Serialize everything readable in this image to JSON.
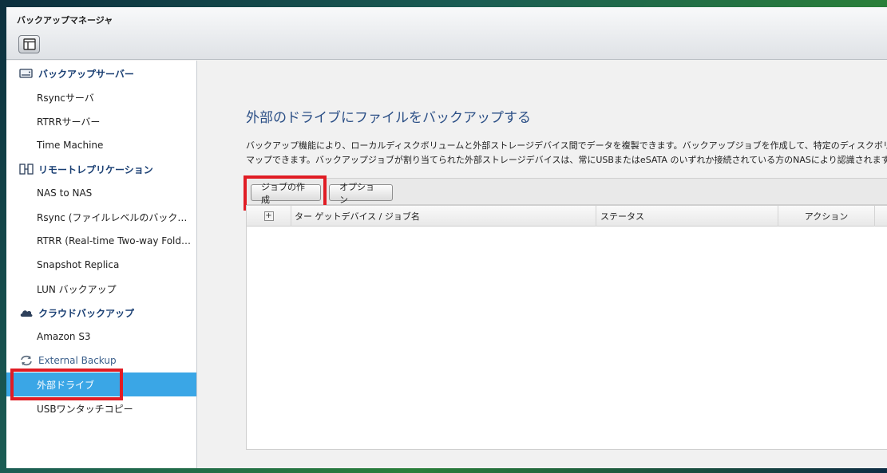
{
  "window": {
    "title": "バックアップマネージャ",
    "toolbar_icon": "panel-toggle-icon"
  },
  "sidebar": {
    "groups": [
      {
        "label": "バックアップサーバー",
        "icon": "server-icon",
        "items": [
          {
            "label": "Rsyncサーバ"
          },
          {
            "label": "RTRRサーバー"
          },
          {
            "label": "Time Machine"
          }
        ]
      },
      {
        "label": "リモートレプリケーション",
        "icon": "replication-icon",
        "items": [
          {
            "label": "NAS to NAS"
          },
          {
            "label": "Rsync (ファイルレベルのバックアップ)"
          },
          {
            "label": "RTRR (Real-time Two-way Folder Sync)"
          },
          {
            "label": "Snapshot Replica"
          },
          {
            "label": "LUN バックアップ"
          }
        ]
      },
      {
        "label": "クラウドバックアップ",
        "icon": "cloud-icon",
        "items": [
          {
            "label": "Amazon S3"
          }
        ]
      },
      {
        "label": "External Backup",
        "icon": "sync-arrows-icon",
        "items": [
          {
            "label": "外部ドライブ",
            "active": true
          },
          {
            "label": "USBワンタッチコピー"
          }
        ]
      }
    ],
    "active_color": "#3aa6e6"
  },
  "main": {
    "title": "外部のドライブにファイルをバックアップする",
    "description_line1": "バックアップ機能により、ローカルディスクボリュームと外部ストレージデバイス間でデータを複製できます。バックアップジョブを作成して、特定のディスクボリュー",
    "description_line2": "マップできます。バックアップジョブが割り当てられた外部ストレージデバイスは、常にUSBまたはeSATA のいずれか接続されている方のNASにより認識されます",
    "buttons": {
      "create_job": "ジョブの作成",
      "options": "オプション"
    },
    "table": {
      "columns": [
        "ター ゲットデバイス / ジョブ名",
        "ステータス",
        "アクション"
      ],
      "expand_icon": "plus-expand-icon"
    }
  },
  "colors": {
    "highlight": "#e01c24",
    "title_blue": "#2b4f86"
  }
}
